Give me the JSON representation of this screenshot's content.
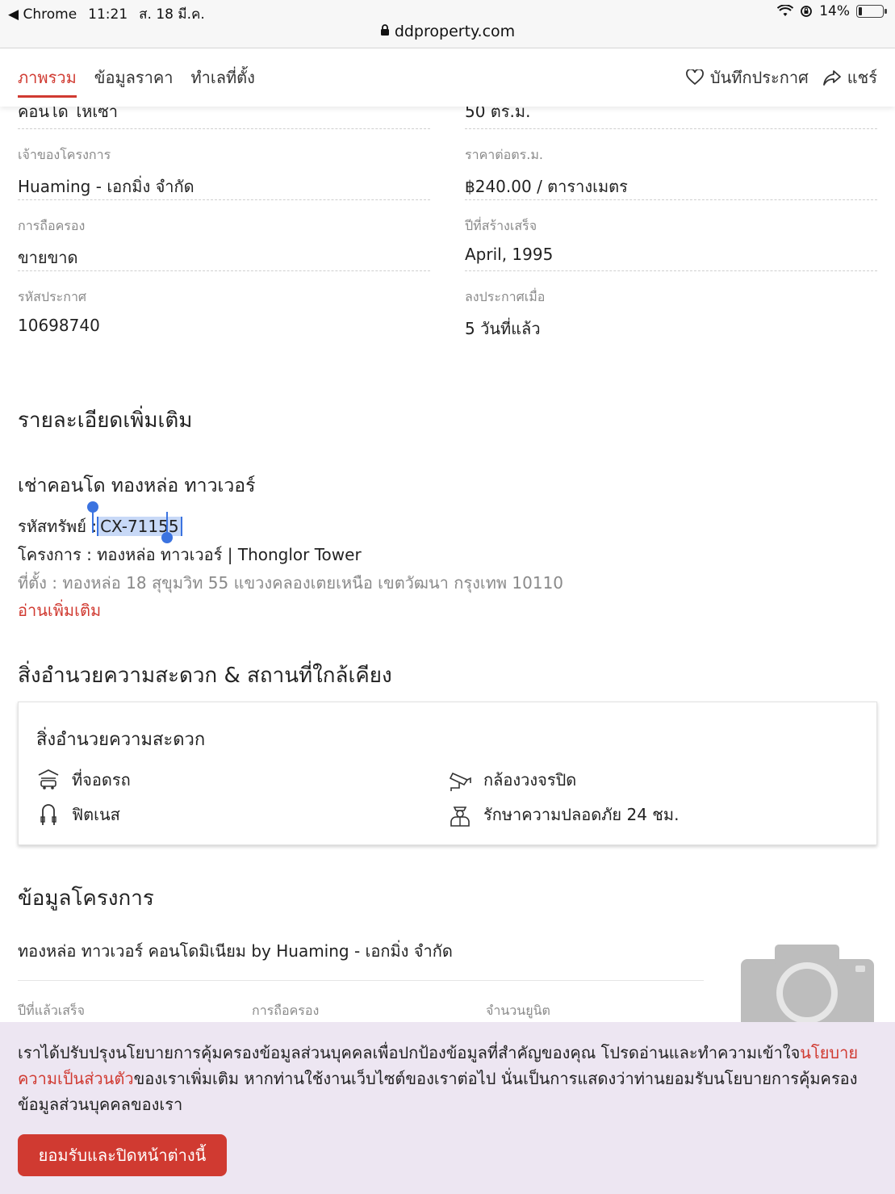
{
  "status_bar": {
    "back_app": "Chrome",
    "time": "11:21",
    "date": "ส. 18 มี.ค.",
    "battery": "14%",
    "battery_level": 0.14
  },
  "browser": {
    "url": "ddproperty.com"
  },
  "nav": {
    "tabs": [
      "ภาพรวม",
      "ข้อมูลราคา",
      "ทำเลที่ตั้ง"
    ],
    "active_tab": 0,
    "save_label": "บันทึกประกาศ",
    "share_label": "แชร์"
  },
  "details": {
    "clipped_left": "คอนโด ไหเซา",
    "clipped_right": "50 ตร.ม.",
    "rows": [
      {
        "left_label": "เจ้าของโครงการ",
        "left_value": "Huaming - เอกมิ่ง จำกัด",
        "right_label": "ราคาต่อตร.ม.",
        "right_value": "฿240.00 / ตารางเมตร"
      },
      {
        "left_label": "การถือครอง",
        "left_value": "ขายขาด",
        "right_label": "ปีที่สร้างเสร็จ",
        "right_value": "April, 1995"
      },
      {
        "left_label": "รหัสประกาศ",
        "left_value": "10698740",
        "right_label": "ลงประกาศเมื่อ",
        "right_value": "5 วันที่แล้ว"
      }
    ]
  },
  "more_details": {
    "heading": "รายละเอียดเพิ่มเติม",
    "title": "เช่าคอนโด ทองหล่อ ทาวเวอร์",
    "code_label": "รหัสทรัพย์ :",
    "code_value": "CX-71155",
    "project_line": "โครงการ : ทองหล่อ ทาวเวอร์ | Thonglor Tower",
    "location_line": "ที่ตั้ง : ทองหล่อ 18 สุขุมวิท 55 แขวงคลองเตยเหนือ เขตวัฒนา กรุงเทพ 10110",
    "read_more": "อ่านเพิ่มเติม"
  },
  "amenities": {
    "heading": "สิ่งอำนวยความสะดวก & สถานที่ใกล้เคียง",
    "card_title": "สิ่งอำนวยความสะดวก",
    "items": [
      {
        "icon": "parking-icon",
        "label": "ที่จอดรถ"
      },
      {
        "icon": "cctv-icon",
        "label": "กล้องวงจรปิด"
      },
      {
        "icon": "fitness-icon",
        "label": "ฟิตเนส"
      },
      {
        "icon": "security-guard-icon",
        "label": "รักษาความปลอดภัย 24 ชม."
      }
    ]
  },
  "project": {
    "heading": "ข้อมูลโครงการ",
    "description": "ทองหล่อ ทาวเวอร์ คอนโดมิเนียม by Huaming - เอกมิ่ง จำกัด",
    "labels": [
      "ปีที่แล้วเสร็จ",
      "การถือครอง",
      "จำนวนยูนิต"
    ]
  },
  "cookie": {
    "text_before": "เราได้ปรับปรุงนโยบายการคุ้มครองข้อมูลส่วนบุคคลเพื่อปกป้องข้อมูลที่สำคัญของคุณ โปรดอ่านและทำความเข้าใจ",
    "link": "นโยบายความเป็นส่วนตัว",
    "text_after": "ของเราเพิ่มเติม หากท่านใช้งานเว็บไซต์ของเราต่อไป นั่นเป็นการแสดงว่าท่านยอมรับนโยบายการคุ้มครองข้อมูลส่วนบุคคลของเรา",
    "button": "ยอมรับและปิดหน้าต่างนี้"
  },
  "colors": {
    "accent": "#d03a31",
    "banner_bg": "#ede6f2",
    "selection": "#c8d9f7"
  }
}
